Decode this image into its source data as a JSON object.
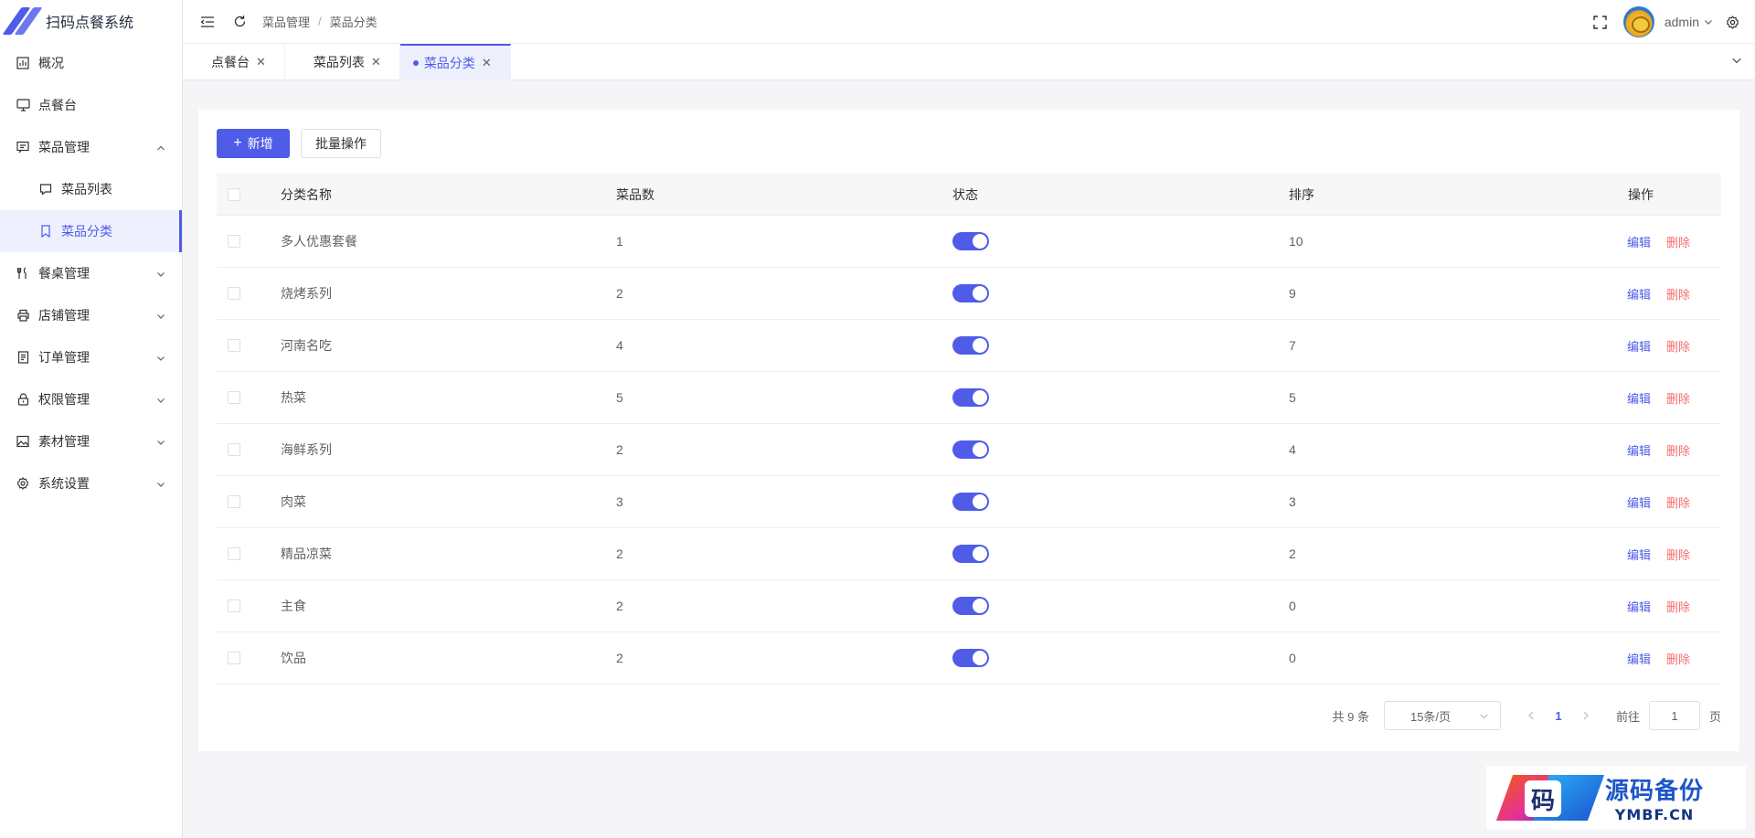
{
  "app": {
    "title": "扫码点餐系统"
  },
  "sidebar": {
    "items": [
      {
        "label": "概况",
        "icon": "chart-icon"
      },
      {
        "label": "点餐台",
        "icon": "monitor-icon"
      },
      {
        "label": "菜品管理",
        "icon": "message-icon",
        "expanded": true
      },
      {
        "label": "菜品列表",
        "icon": "chat-icon",
        "sub": true
      },
      {
        "label": "菜品分类",
        "icon": "bookmark-icon",
        "sub": true,
        "active": true
      },
      {
        "label": "餐桌管理",
        "icon": "fork-knife-icon"
      },
      {
        "label": "店铺管理",
        "icon": "printer-icon"
      },
      {
        "label": "订单管理",
        "icon": "document-icon"
      },
      {
        "label": "权限管理",
        "icon": "lock-icon"
      },
      {
        "label": "素材管理",
        "icon": "picture-icon"
      },
      {
        "label": "系统设置",
        "icon": "gear-icon"
      }
    ]
  },
  "header": {
    "breadcrumb": [
      "菜品管理",
      "菜品分类"
    ],
    "user": "admin"
  },
  "tabs": [
    {
      "label": "点餐台"
    },
    {
      "label": "菜品列表"
    },
    {
      "label": "菜品分类",
      "active": true
    }
  ],
  "toolbar": {
    "add_label": "新增",
    "batch_label": "批量操作"
  },
  "table": {
    "columns": [
      "分类名称",
      "菜品数",
      "状态",
      "排序",
      "操作"
    ],
    "rows": [
      {
        "name": "多人优惠套餐",
        "count": "1",
        "enabled": true,
        "sort": "10"
      },
      {
        "name": "烧烤系列",
        "count": "2",
        "enabled": true,
        "sort": "9"
      },
      {
        "name": "河南名吃",
        "count": "4",
        "enabled": true,
        "sort": "7"
      },
      {
        "name": "热菜",
        "count": "5",
        "enabled": true,
        "sort": "5"
      },
      {
        "name": "海鲜系列",
        "count": "2",
        "enabled": true,
        "sort": "4"
      },
      {
        "name": "肉菜",
        "count": "3",
        "enabled": true,
        "sort": "3"
      },
      {
        "name": "精品凉菜",
        "count": "2",
        "enabled": true,
        "sort": "2"
      },
      {
        "name": "主食",
        "count": "2",
        "enabled": true,
        "sort": "0"
      },
      {
        "name": "饮品",
        "count": "2",
        "enabled": true,
        "sort": "0"
      }
    ],
    "edit_label": "编辑",
    "delete_label": "删除"
  },
  "pagination": {
    "total": "共 9 条",
    "page_size": "15条/页",
    "current": "1",
    "goto_prefix": "前往",
    "goto_value": "1",
    "goto_suffix": "页"
  },
  "watermark": {
    "badge": "码",
    "title": "源码备份",
    "site": "YMBF.CN"
  },
  "colors": {
    "primary": "#4e5ce8",
    "danger": "#f56c6c"
  }
}
